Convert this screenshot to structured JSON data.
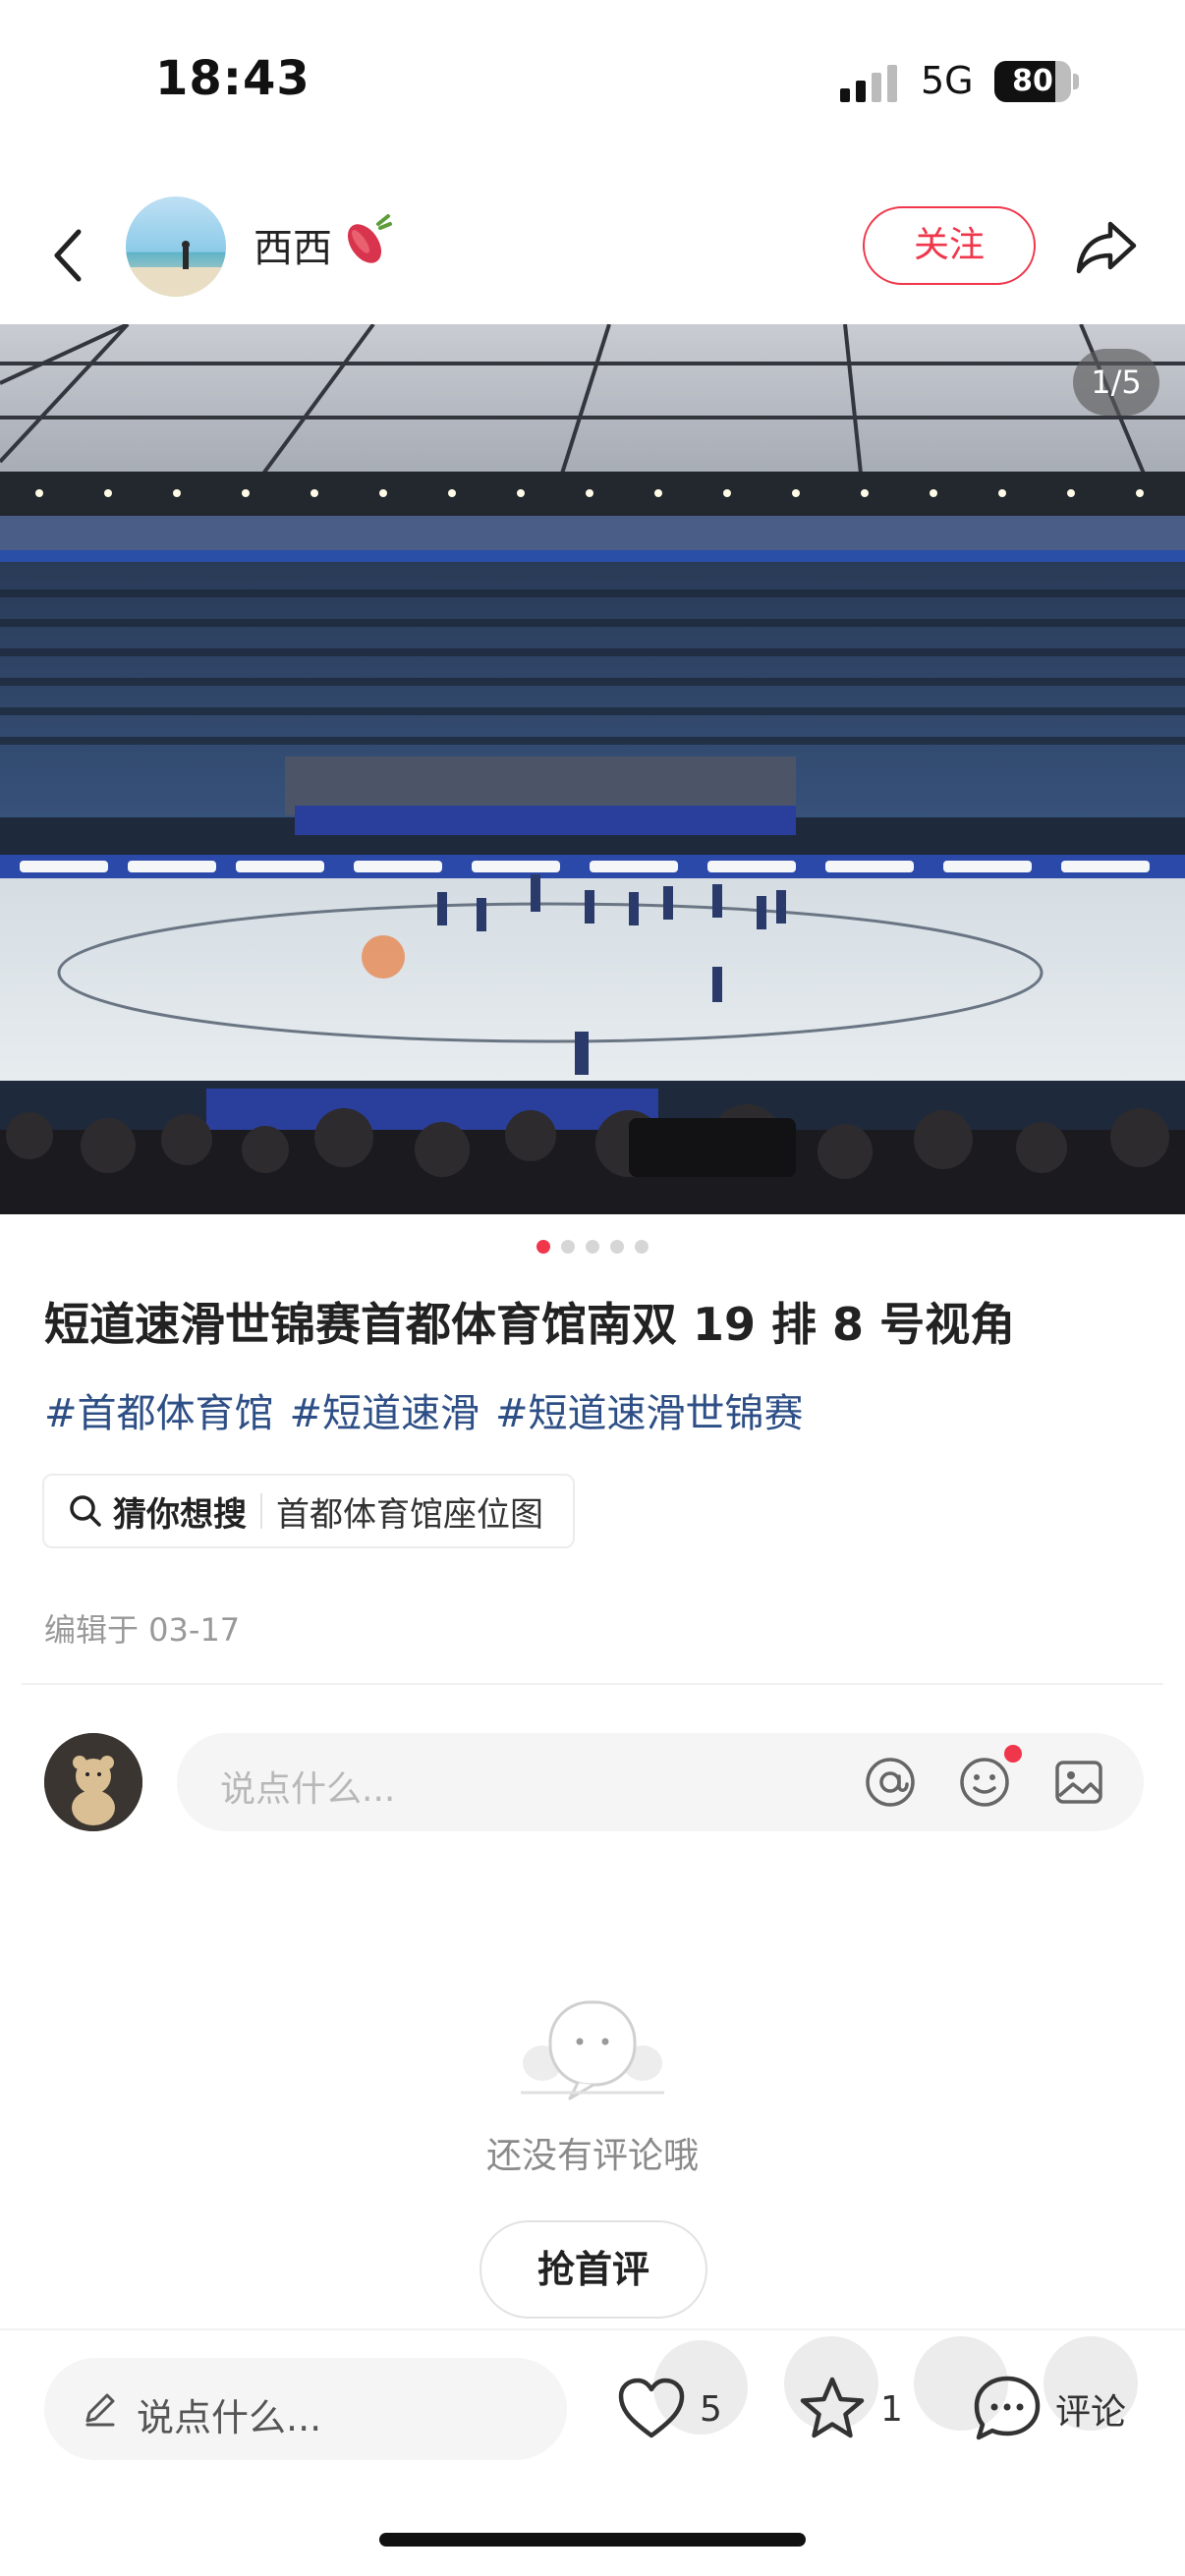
{
  "status_bar": {
    "time": "18:43",
    "network": "5G",
    "battery": "80",
    "battery_level": 0.8
  },
  "header": {
    "back_icon": "chevron-left-icon",
    "author_name": "西西",
    "author_emoji": "sweet-potato-icon",
    "follow_label": "关注",
    "share_icon": "share-arrow-icon"
  },
  "photo": {
    "page_counter": "1/5",
    "total_pages": 5,
    "current_page": 1
  },
  "post": {
    "title": "短道速滑世锦赛首都体育馆南双 19 排 8 号视角",
    "tags": [
      "#首都体育馆",
      "#短道速滑",
      "#短道速滑世锦赛"
    ],
    "guess_label": "猜你想搜",
    "guess_query": "首都体育馆座位图",
    "edit_time": "编辑于 03-17"
  },
  "comment_input": {
    "placeholder": "说点什么..."
  },
  "empty_state": {
    "text": "还没有评论哦",
    "button_label": "抢首评"
  },
  "bottom_bar": {
    "input_placeholder": "说点什么...",
    "likes": "5",
    "stars": "1",
    "comment_label": "评论"
  },
  "colors": {
    "accent": "#f0364a",
    "tag_link": "#2e4f86"
  }
}
